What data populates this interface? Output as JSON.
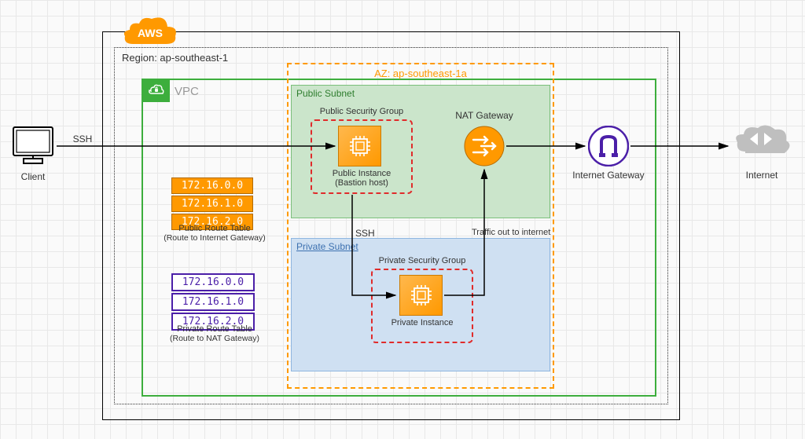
{
  "cloud_provider": "AWS",
  "region_label": "Region: ap-southeast-1",
  "vpc_label": "VPC",
  "az_label": "AZ: ap-southeast-1a",
  "public_subnet_label": "Public Subnet",
  "private_subnet_label": "Private Subnet",
  "client_label": "Client",
  "internet_label": "Internet",
  "public_sg_label": "Public Security Group",
  "private_sg_label": "Private Security Group",
  "public_instance_label": "Public Instance\n(Bastion host)",
  "private_instance_label": "Private Instance",
  "nat_label": "NAT Gateway",
  "igw_label": "Internet Gateway",
  "ssh_label_1": "SSH",
  "ssh_label_2": "SSH",
  "traffic_label": "Traffic out to internet",
  "public_rt": {
    "cidrs": [
      "172.16.0.0",
      "172.16.1.0",
      "172.16.2.0"
    ],
    "title": "Public Route Table",
    "subtitle": "(Route to Internet Gateway)"
  },
  "private_rt": {
    "cidrs": [
      "172.16.0.0",
      "172.16.1.0",
      "172.16.2.0"
    ],
    "title": "Private Route Table",
    "subtitle": "(Route to NAT Gateway)"
  },
  "colors": {
    "aws_orange": "#ff9900",
    "vpc_green": "#3dae3d",
    "nat_fill": "#ff9900",
    "igw_purple": "#4b1fa8",
    "public_subnet_fill": "#cbe5cb",
    "private_subnet_fill": "#cfe0f2",
    "sg_red": "#e02b2b"
  }
}
